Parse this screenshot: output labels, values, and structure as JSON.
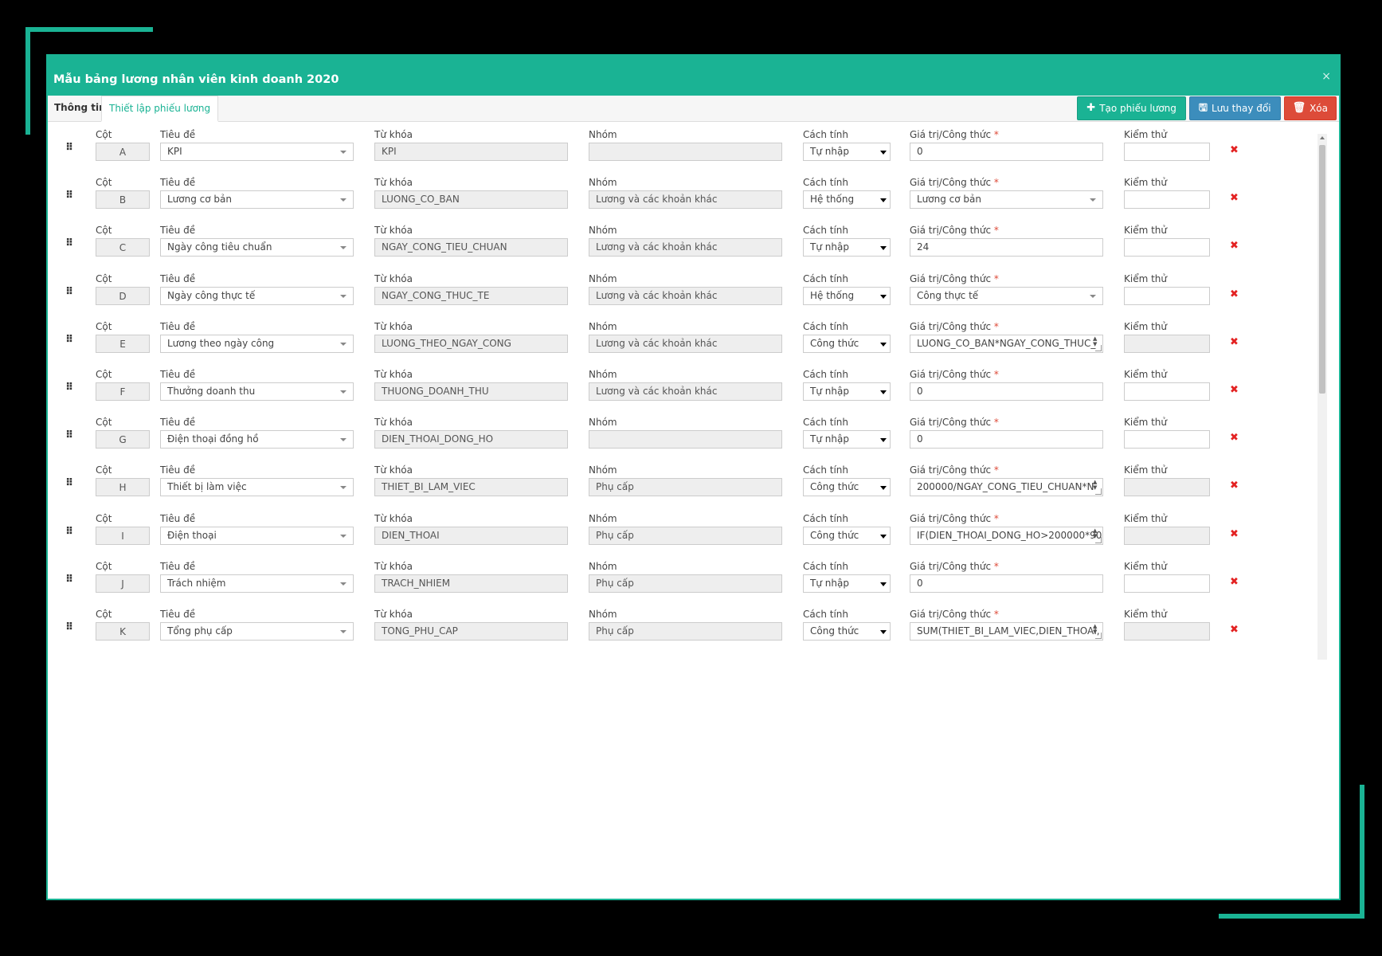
{
  "dialog": {
    "title": "Mẫu bảng lương nhân viên kinh doanh 2020",
    "close": "×"
  },
  "tabs": [
    "Thông tin",
    "Thiết lập phiếu lương"
  ],
  "actions": {
    "create": "Tạo phiếu lương",
    "save": "Lưu thay đổi",
    "delete": "Xóa"
  },
  "labels": {
    "col": "Cột",
    "title": "Tiêu đề",
    "key": "Từ khóa",
    "group": "Nhóm",
    "calc": "Cách tính",
    "value": "Giá trị/Công thức",
    "required": "*",
    "test": "Kiểm thử"
  },
  "rows": [
    {
      "col": "A",
      "title": "KPI",
      "key": "KPI",
      "group": "",
      "calc": "Tự nhập",
      "value": "0",
      "value_kind": "input",
      "test": ""
    },
    {
      "col": "B",
      "title": "Lương cơ bản",
      "key": "LUONG_CO_BAN",
      "group": "Lương và các khoản khác",
      "calc": "Hệ thống",
      "value": "Lương cơ bản",
      "value_kind": "select",
      "test": ""
    },
    {
      "col": "C",
      "title": "Ngày công tiêu chuẩn",
      "key": "NGAY_CONG_TIEU_CHUAN",
      "group": "Lương và các khoản khác",
      "calc": "Tự nhập",
      "value": "24",
      "value_kind": "input",
      "test": ""
    },
    {
      "col": "D",
      "title": "Ngày công thực tế",
      "key": "NGAY_CONG_THUC_TE",
      "group": "Lương và các khoản khác",
      "calc": "Hệ thống",
      "value": "Công thực tế",
      "value_kind": "select",
      "test": ""
    },
    {
      "col": "E",
      "title": "Lương theo ngày công",
      "key": "LUONG_THEO_NGAY_CONG",
      "group": "Lương và các khoản khác",
      "calc": "Công thức",
      "value": "LUONG_CO_BAN*NGAY_CONG_THUC_",
      "value_kind": "formula",
      "test": ""
    },
    {
      "col": "F",
      "title": "Thưởng doanh thu",
      "key": "THUONG_DOANH_THU",
      "group": "Lương và các khoản khác",
      "calc": "Tự nhập",
      "value": "0",
      "value_kind": "input",
      "test": ""
    },
    {
      "col": "G",
      "title": "Điện thoại đồng hồ",
      "key": "DIEN_THOAI_DONG_HO",
      "group": "",
      "calc": "Tự nhập",
      "value": "0",
      "value_kind": "input",
      "test": ""
    },
    {
      "col": "H",
      "title": "Thiết bị làm việc",
      "key": "THIET_BI_LAM_VIEC",
      "group": "Phụ cấp",
      "calc": "Công thức",
      "value": "200000/NGAY_CONG_TIEU_CHUAN*N",
      "value_kind": "formula",
      "test": ""
    },
    {
      "col": "I",
      "title": "Điện thoại",
      "key": "DIEN_THOAI",
      "group": "Phụ cấp",
      "calc": "Công thức",
      "value": "IF(DIEN_THOAI_DONG_HO>200000*90",
      "value_kind": "formula",
      "test": ""
    },
    {
      "col": "J",
      "title": "Trách nhiệm",
      "key": "TRACH_NHIEM",
      "group": "Phụ cấp",
      "calc": "Tự nhập",
      "value": "0",
      "value_kind": "input",
      "test": ""
    },
    {
      "col": "K",
      "title": "Tổng phụ cấp",
      "key": "TONG_PHU_CAP",
      "group": "Phụ cấp",
      "calc": "Công thức",
      "value": "SUM(THIET_BI_LAM_VIEC,DIEN_THOAI,",
      "value_kind": "formula",
      "test": ""
    }
  ],
  "colors": {
    "accent": "#1ab394",
    "save": "#3c8dbc",
    "danger": "#dd4b39",
    "delete_icon": "#e32222"
  }
}
